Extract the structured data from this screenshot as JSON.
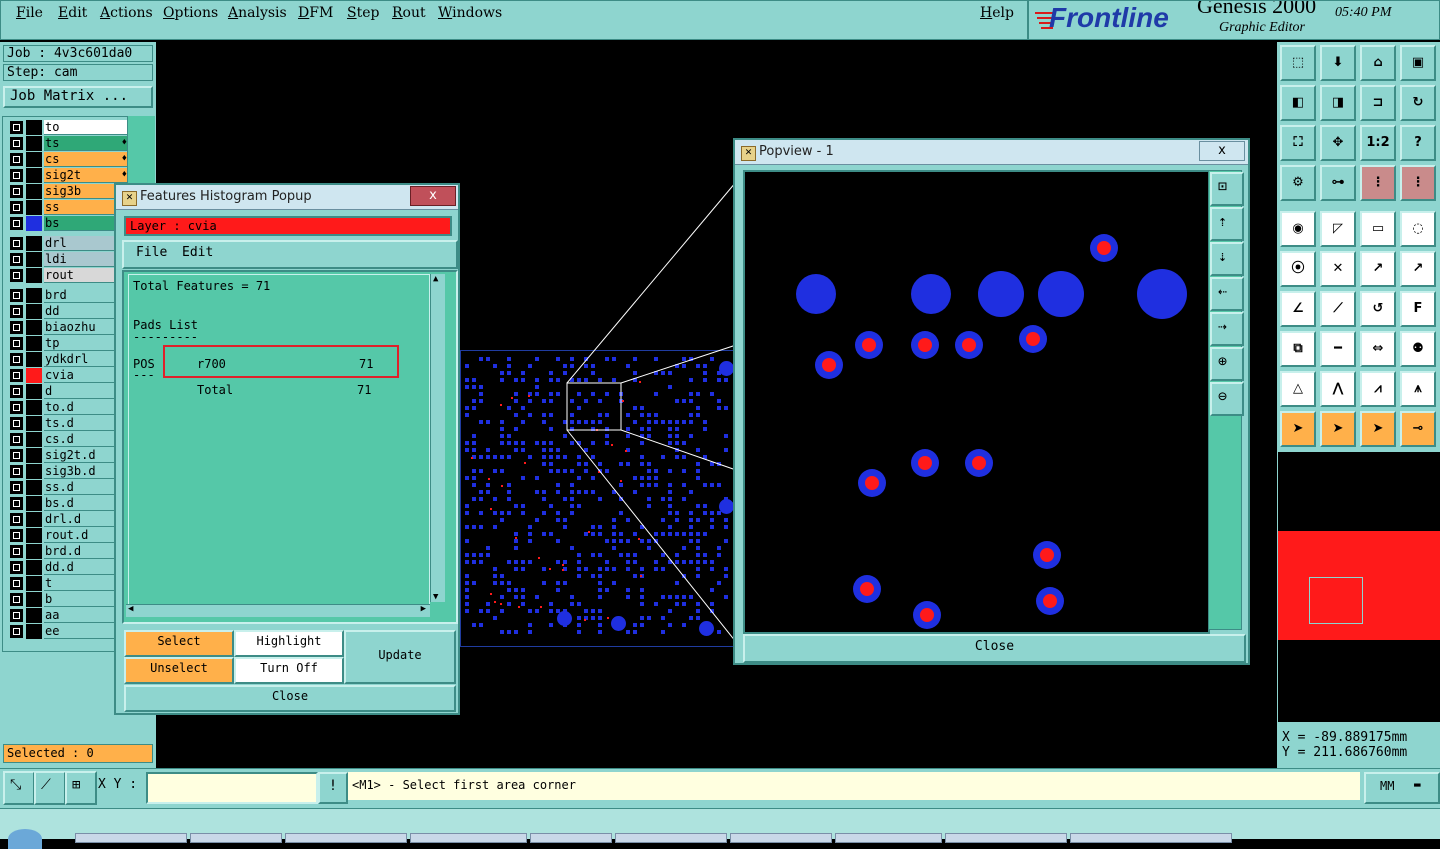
{
  "menubar": {
    "items": [
      "File",
      "Edit",
      "Actions",
      "Options",
      "Analysis",
      "DFM",
      "Step",
      "Rout",
      "Windows"
    ],
    "help": "Help"
  },
  "brand": {
    "logo": "Frontline",
    "product": "Genesis 2000",
    "subtitle": "Graphic Editor",
    "time": "05:40 PM"
  },
  "job": {
    "job_line": "Job : 4v3c601da0",
    "step_line": "Step: cam",
    "matrix_button": "Job Matrix ..."
  },
  "layers": [
    {
      "name": "to",
      "bg": "#ffffff",
      "color": "#000000",
      "mark": ""
    },
    {
      "name": "ts",
      "bg": "#2fa877",
      "color": "#000000",
      "mark": "♦"
    },
    {
      "name": "cs",
      "bg": "#ffb04a",
      "color": "#000000",
      "mark": "♦"
    },
    {
      "name": "sig2t",
      "bg": "#ffb04a",
      "color": "#000000",
      "mark": "♦"
    },
    {
      "name": "sig3b",
      "bg": "#ffb04a",
      "color": "#000000",
      "mark": "♦"
    },
    {
      "name": "ss",
      "bg": "#ffb04a",
      "color": "#000000",
      "mark": ""
    },
    {
      "name": "bs",
      "bg": "#2fa877",
      "color": "#1f2fe0",
      "mark": ""
    },
    {
      "name": "drl",
      "bg": "#a9c8cf",
      "color": "#000000",
      "mark": ""
    },
    {
      "name": "ldi",
      "bg": "#a9c8cf",
      "color": "#000000",
      "mark": ""
    },
    {
      "name": "rout",
      "bg": "#d8d8d8",
      "color": "#000000",
      "mark": ""
    },
    {
      "name": "brd",
      "bg": "#8ed5cf",
      "color": "#000000",
      "mark": ""
    },
    {
      "name": "dd",
      "bg": "#8ed5cf",
      "color": "#000000",
      "mark": ""
    },
    {
      "name": "biaozhu",
      "bg": "#8ed5cf",
      "color": "#000000",
      "mark": ""
    },
    {
      "name": "tp",
      "bg": "#8ed5cf",
      "color": "#000000",
      "mark": ""
    },
    {
      "name": "ydkdrl",
      "bg": "#8ed5cf",
      "color": "#000000",
      "mark": ""
    },
    {
      "name": "cvia",
      "bg": "#8ed5cf",
      "color": "#ff1a1a",
      "mark": ""
    },
    {
      "name": "d",
      "bg": "#8ed5cf",
      "color": "#000000",
      "mark": ""
    },
    {
      "name": "to.d",
      "bg": "#8ed5cf",
      "color": "#000000",
      "mark": ""
    },
    {
      "name": "ts.d",
      "bg": "#8ed5cf",
      "color": "#000000",
      "mark": ""
    },
    {
      "name": "cs.d",
      "bg": "#8ed5cf",
      "color": "#000000",
      "mark": ""
    },
    {
      "name": "sig2t.d",
      "bg": "#8ed5cf",
      "color": "#000000",
      "mark": ""
    },
    {
      "name": "sig3b.d",
      "bg": "#8ed5cf",
      "color": "#000000",
      "mark": ""
    },
    {
      "name": "ss.d",
      "bg": "#8ed5cf",
      "color": "#000000",
      "mark": ""
    },
    {
      "name": "bs.d",
      "bg": "#8ed5cf",
      "color": "#000000",
      "mark": ""
    },
    {
      "name": "drl.d",
      "bg": "#8ed5cf",
      "color": "#000000",
      "mark": ""
    },
    {
      "name": "rout.d",
      "bg": "#8ed5cf",
      "color": "#000000",
      "mark": ""
    },
    {
      "name": "brd.d",
      "bg": "#8ed5cf",
      "color": "#000000",
      "mark": ""
    },
    {
      "name": "dd.d",
      "bg": "#8ed5cf",
      "color": "#000000",
      "mark": ""
    },
    {
      "name": "t",
      "bg": "#8ed5cf",
      "color": "#000000",
      "mark": ""
    },
    {
      "name": "b",
      "bg": "#8ed5cf",
      "color": "#000000",
      "mark": ""
    },
    {
      "name": "aa",
      "bg": "#8ed5cf",
      "color": "#000000",
      "mark": ""
    },
    {
      "name": "ee",
      "bg": "#8ed5cf",
      "color": "#000000",
      "mark": ""
    }
  ],
  "selected": "Selected : 0",
  "histogram": {
    "title": "Features Histogram Popup",
    "close_x": "x",
    "layer": "Layer :  cvia",
    "menu": {
      "file": "File",
      "edit": "Edit"
    },
    "total_features": "Total Features = 71",
    "pads_list": "Pads List",
    "pads_underline": "---------",
    "pos_label": "POS",
    "pos_underline": "---",
    "row_symbol": "r700",
    "row_count": "71",
    "total_label": "Total",
    "total_count": "71",
    "buttons": {
      "select": "Select",
      "highlight": "Highlight",
      "unselect": "Unselect",
      "turn_off": "Turn Off",
      "update": "Update",
      "close": "Close"
    }
  },
  "popview": {
    "title": "Popview - 1",
    "close_x": "x",
    "close_button": "Close"
  },
  "coords": {
    "x": "X = -89.889175mm",
    "y": "Y = 211.686760mm"
  },
  "bottom": {
    "xy_label": "X Y :",
    "xy_value": "",
    "warn": "!",
    "message": "<M1> - Select first area corner",
    "units": "MM"
  },
  "toolbar_labels": {
    "ratio": "1:2",
    "help": "?"
  },
  "colors": {
    "ui_teal": "#8ed5cf",
    "panel_mint": "#55c8a8",
    "pad_blue": "#1f2fe0",
    "via_red": "#ff1a1a",
    "select_orange": "#ffb04a"
  }
}
